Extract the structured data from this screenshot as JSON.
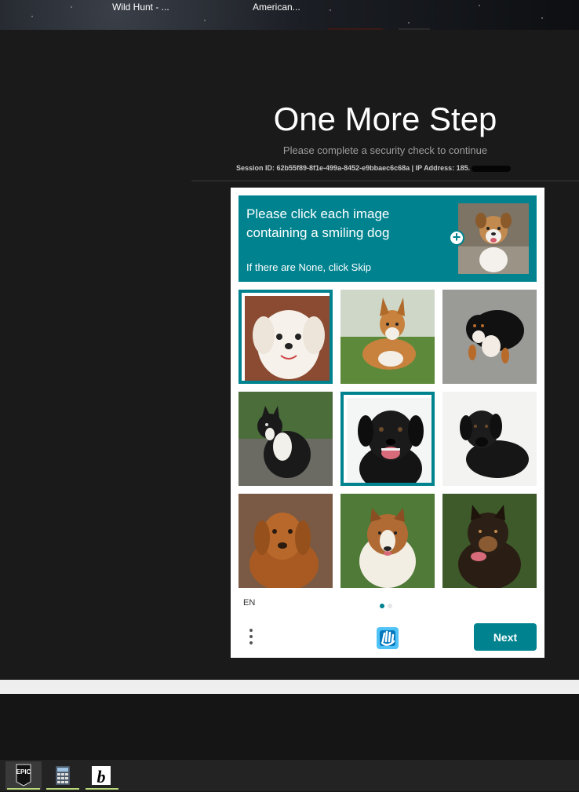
{
  "desktop": {
    "items": [
      "Wild Hunt - ...",
      "American..."
    ]
  },
  "page": {
    "title": "One More Step",
    "subtitle": "Please complete a security check to continue",
    "session_text": "Session ID: 62b55f89-8f1e-499a-8452-e9bbaec6c68a | IP Address: 185."
  },
  "captcha": {
    "prompt_line": "Please click each image containing a smiling dog",
    "skip_hint": "If there are None, click Skip",
    "language": "EN",
    "next_label": "Next",
    "page_indicator": {
      "current": 1,
      "total": 2
    },
    "images": [
      {
        "desc": "white fluffy dog",
        "selected": true
      },
      {
        "desc": "corgi on grass",
        "selected": false
      },
      {
        "desc": "tricolor dog",
        "selected": false
      },
      {
        "desc": "black and white dog sitting",
        "selected": false
      },
      {
        "desc": "black labrador smiling",
        "selected": true
      },
      {
        "desc": "black dog lying",
        "selected": false
      },
      {
        "desc": "golden retriever",
        "selected": false
      },
      {
        "desc": "sheltie",
        "selected": false
      },
      {
        "desc": "brown and black dog",
        "selected": false
      }
    ],
    "accent_color": "#00838f"
  },
  "taskbar": {
    "apps": [
      {
        "name": "epic-games",
        "label": "EPIC"
      },
      {
        "name": "calculator",
        "label": ""
      },
      {
        "name": "bing",
        "label": "b"
      }
    ]
  }
}
